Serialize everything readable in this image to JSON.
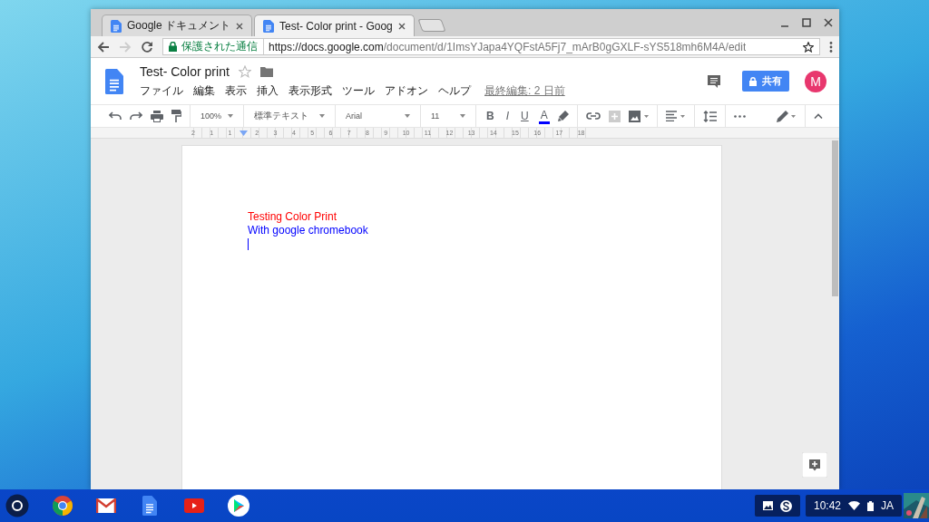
{
  "window": {
    "tabs": [
      {
        "title": "Google ドキュメント",
        "selected": false
      },
      {
        "title": "Test- Color print - Goog",
        "selected": true
      }
    ]
  },
  "address_bar": {
    "security": "保護された通信",
    "url_host": "https://docs.google.com",
    "url_path": "/document/d/1ImsYJapa4YQFstA5Fj7_mArB0gGXLF-sYS518mh6M4A/edit"
  },
  "doc_header": {
    "title": "Test- Color print",
    "starred": false,
    "menus": [
      "ファイル",
      "編集",
      "表示",
      "挿入",
      "表示形式",
      "ツール",
      "アドオン",
      "ヘルプ"
    ],
    "last_edit": "最終編集: 2 日前",
    "share_label": "共有",
    "avatar": "M"
  },
  "toolbar": {
    "zoom": "100%",
    "style": "標準テキスト",
    "font": "Arial",
    "size": "11",
    "bold": "B",
    "italic": "I",
    "underline": "U",
    "text_color": "A"
  },
  "ruler": [
    "2",
    "1",
    "1",
    "2",
    "3",
    "4",
    "5",
    "6",
    "7",
    "8",
    "9",
    "10",
    "11",
    "12",
    "13",
    "14",
    "15",
    "16",
    "17",
    "18"
  ],
  "document": {
    "lines": [
      {
        "text": "Testing Color Print",
        "color": "#ff0000"
      },
      {
        "text": "With google chromebook",
        "color": "#0000ff"
      }
    ]
  },
  "shelf": {
    "time": "10:42",
    "ime": "JA"
  }
}
